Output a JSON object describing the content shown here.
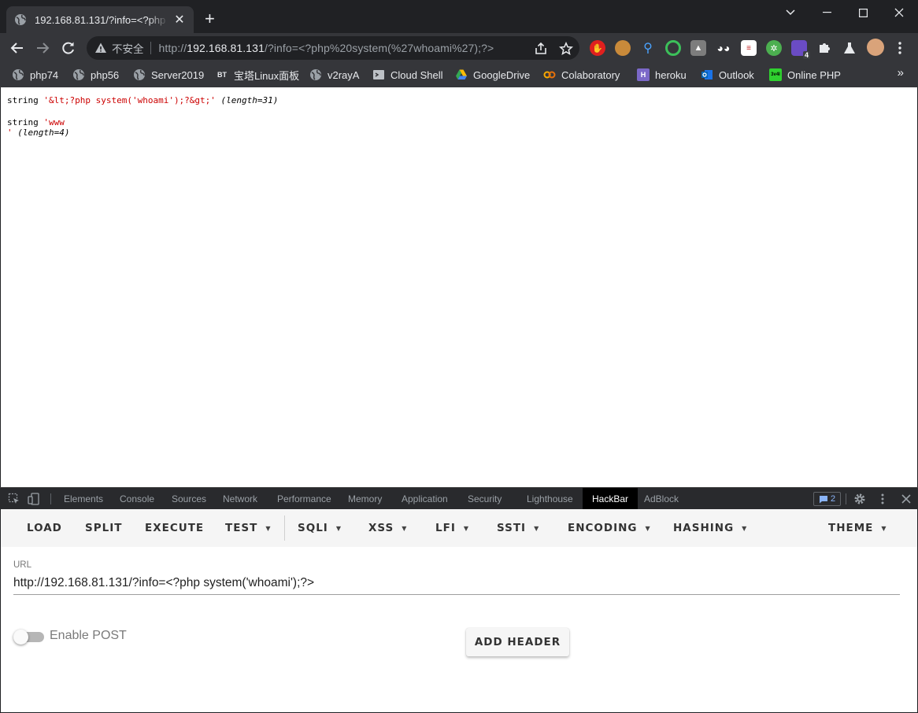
{
  "browser": {
    "tab": {
      "title": "192.168.81.131/?info=<?php s"
    },
    "omnibox": {
      "security_label": "不安全",
      "url_prefix": "http://",
      "url_host": "192.168.81.131",
      "url_path": "/?info=<?php%20system(%27whoami%27);?>"
    },
    "bookmarks": [
      {
        "label": "php74",
        "icon": "globe-icon"
      },
      {
        "label": "php56",
        "icon": "globe-icon"
      },
      {
        "label": "Server2019",
        "icon": "globe-icon"
      },
      {
        "label": "宝塔Linux面板",
        "icon": "bt-icon",
        "icon_text": "BT"
      },
      {
        "label": "v2rayA",
        "icon": "globe-icon"
      },
      {
        "label": "Cloud Shell",
        "icon": "cloud-shell-icon"
      },
      {
        "label": "GoogleDrive",
        "icon": "google-drive-icon"
      },
      {
        "label": "Colaboratory",
        "icon": "colab-icon"
      },
      {
        "label": "heroku",
        "icon": "heroku-icon",
        "icon_text": "H"
      },
      {
        "label": "Outlook",
        "icon": "outlook-icon"
      },
      {
        "label": "Online PHP",
        "icon": "online-php-icon",
        "icon_text": "3v4l"
      }
    ],
    "extensions_badge": "4"
  },
  "page": {
    "line1": {
      "type": "string",
      "value": "'&lt;?php system('whoami');?&gt;'",
      "length": "(length=31)"
    },
    "line2": {
      "type": "string",
      "value": "'www",
      "value_end": "'",
      "length": "(length=4)"
    }
  },
  "devtools": {
    "tabs": [
      "Elements",
      "Console",
      "Sources",
      "Network",
      "Performance",
      "Memory",
      "Application",
      "Security",
      "Lighthouse",
      "HackBar",
      "AdBlock"
    ],
    "active_tab": "HackBar",
    "issues_count": "2"
  },
  "hackbar": {
    "menu": [
      {
        "label": "LOAD",
        "dropdown": false
      },
      {
        "label": "SPLIT",
        "dropdown": false
      },
      {
        "label": "EXECUTE",
        "dropdown": false
      },
      {
        "label": "TEST",
        "dropdown": true
      },
      {
        "label": "SQLI",
        "dropdown": true
      },
      {
        "label": "XSS",
        "dropdown": true
      },
      {
        "label": "LFI",
        "dropdown": true
      },
      {
        "label": "SSTI",
        "dropdown": true
      },
      {
        "label": "ENCODING",
        "dropdown": true
      },
      {
        "label": "HASHING",
        "dropdown": true
      },
      {
        "label": "THEME",
        "dropdown": true
      }
    ],
    "url_label": "URL",
    "url_value": "http://192.168.81.131/?info=<?php system('whoami');?>",
    "enable_post_label": "Enable POST",
    "enable_post": false,
    "add_header_label": "ADD HEADER"
  },
  "colors": {
    "chrome_dark": "#202124",
    "toolbar": "#35363a",
    "xdebug_string": "#cc0000",
    "devtools_bar": "#292a2d"
  }
}
